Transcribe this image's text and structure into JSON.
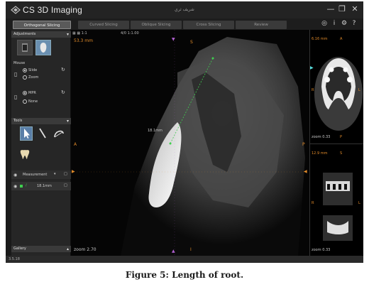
{
  "app": {
    "title": "CS 3D Imaging",
    "patient_name": "شريف ثري",
    "window_controls": [
      "minimize-icon",
      "restore-icon",
      "close-icon"
    ]
  },
  "tabs": [
    {
      "label": "Orthogonal Slicing",
      "active": true
    },
    {
      "label": "Curved Slicing",
      "active": false
    },
    {
      "label": "Oblique Slicing",
      "active": false
    },
    {
      "label": "Cross Slicing",
      "active": false
    },
    {
      "label": "Review",
      "active": false
    }
  ],
  "top_right_icons": [
    "target-icon",
    "info-icon",
    "settings-icon",
    "help-icon"
  ],
  "left_panel": {
    "adjustments_header": "Adjustments",
    "mouse_header": "Mouse",
    "mouse_options": [
      {
        "label": "Slide",
        "selected": true
      },
      {
        "label": "Zoom",
        "selected": false
      }
    ],
    "mpr_options": [
      {
        "label": "MPR",
        "selected": true
      },
      {
        "label": "None",
        "selected": false
      }
    ],
    "tools_header": "Tools",
    "tool_icons": [
      "pointer-icon",
      "pen-icon",
      "arc-icon",
      "tooth-icon"
    ],
    "measurement_label": "Measurement",
    "measurement_item": "18.1mm",
    "gallery_label": "Gallery"
  },
  "main_view": {
    "toolbar_text": "1:1",
    "toolbar_text2": "4/0",
    "toolbar_text3": "1:1.00",
    "slice_mm": "53.3 mm",
    "zoom": "zoom 2.70",
    "measure_label": "18.1mm",
    "orient_top": "S",
    "orient_bottom": "I",
    "orient_left": "A",
    "orient_right": "P"
  },
  "right_panes": {
    "axial": {
      "slice": "6.16 mm",
      "zoom": "zoom 0.33",
      "top": "A",
      "left": "R",
      "right": "L",
      "bottom": "P"
    },
    "coronal": {
      "slice": "12.9 mm",
      "top": "S",
      "left": "R",
      "right": "L",
      "zoom": "zoom 0.33"
    }
  },
  "status_bar": {
    "text": "3.5.18"
  },
  "caption": "Figure 5: Length of root."
}
